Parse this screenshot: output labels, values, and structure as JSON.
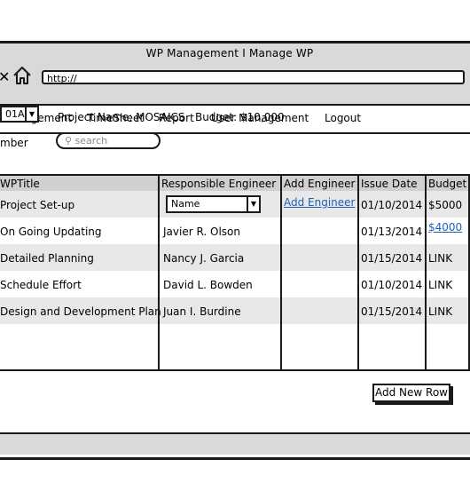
{
  "window": {
    "title": "WP Management I Manage WP",
    "url": "http://"
  },
  "icons": {
    "back": "close-x-icon",
    "home": "home-icon"
  },
  "menu": {
    "items": [
      "Management",
      "TimeSheet",
      "Report",
      "User Management",
      "Logout"
    ]
  },
  "filters": {
    "project_code": "01A",
    "project_name": "Project Name: MOSAICS",
    "budget": "Budget: $10,000",
    "member_label": "mber",
    "search_placeholder": "search"
  },
  "table": {
    "headers": [
      "WPTitle",
      "Responsible Engineer",
      "Add Engineer",
      "Issue Date",
      "Budget"
    ],
    "rows": [
      {
        "title": "Project Set-up",
        "engineer": "Name",
        "engineer_is_select": true,
        "add_engineer": "Add Engineer",
        "issue_date": "01/10/2014",
        "budget": "$5000",
        "budget_is_link": false
      },
      {
        "title": "On Going Updating",
        "engineer": "Javier R. Olson",
        "add_engineer": "",
        "issue_date": "01/13/2014",
        "budget": "$4000",
        "budget_is_link": true
      },
      {
        "title": "Detailed Planning",
        "engineer": "Nancy J. Garcia",
        "add_engineer": "",
        "issue_date": "01/15/2014",
        "budget": "LINK",
        "budget_is_link": false
      },
      {
        "title": "Schedule Effort",
        "engineer": "David L. Bowden",
        "add_engineer": "",
        "issue_date": "01/10/2014",
        "budget": "LINK",
        "budget_is_link": false
      },
      {
        "title": "Design and Development Plan",
        "engineer": "Juan I. Burdine",
        "add_engineer": "",
        "issue_date": "01/15/2014",
        "budget": "LINK",
        "budget_is_link": false
      }
    ]
  },
  "actions": {
    "add_new_row": "Add New Row"
  }
}
